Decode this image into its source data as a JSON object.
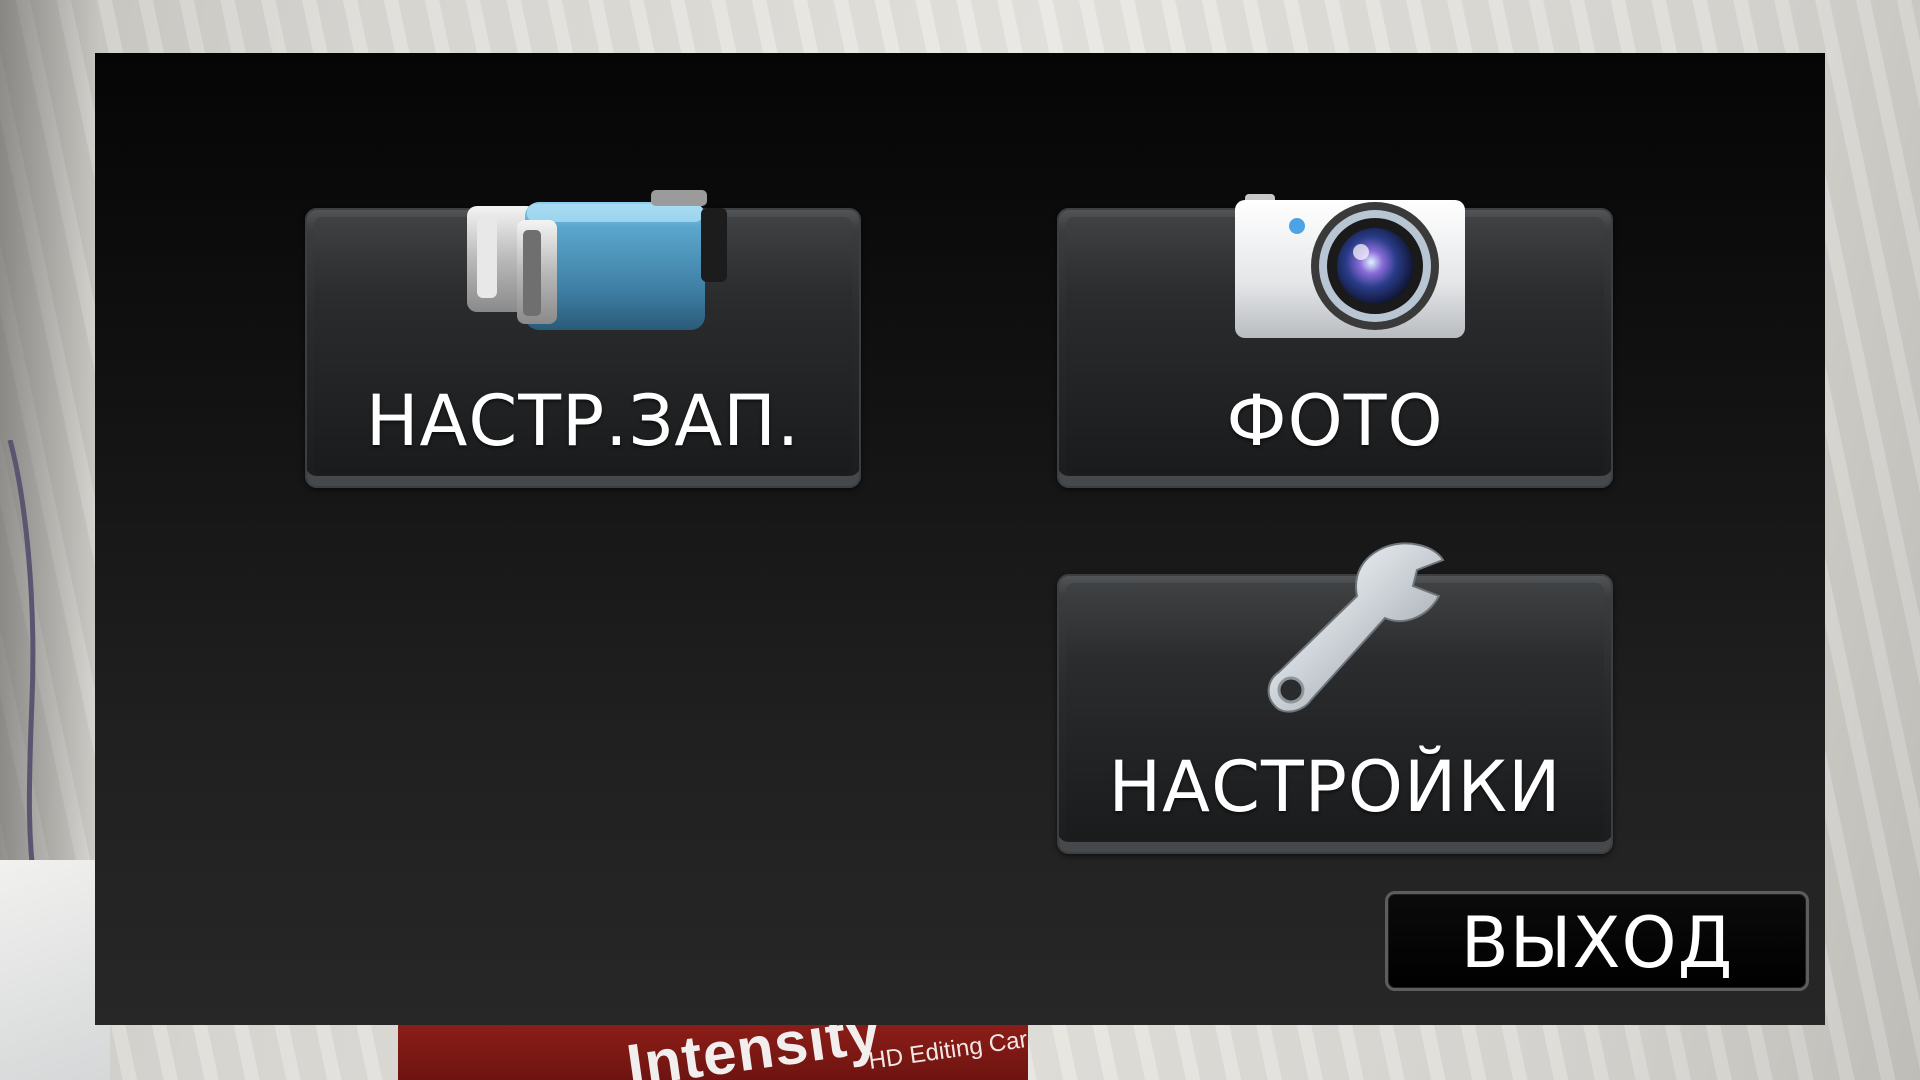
{
  "menu": {
    "items": [
      {
        "label": "НАСТР.ЗАП.",
        "icon": "video-camera-icon"
      },
      {
        "label": "ФОТО",
        "icon": "photo-camera-icon"
      },
      {
        "label": "НАСТРОЙКИ",
        "icon": "wrench-icon"
      }
    ],
    "exit_label": "ВЫХОД"
  },
  "background": {
    "box_brand": "Intensity",
    "box_tagline": "HD Editing Card"
  },
  "colors": {
    "screen_bg": "#111111",
    "tile_bg": "#2a2b2c",
    "text": "#ffffff",
    "box_red": "#8c1d18"
  }
}
